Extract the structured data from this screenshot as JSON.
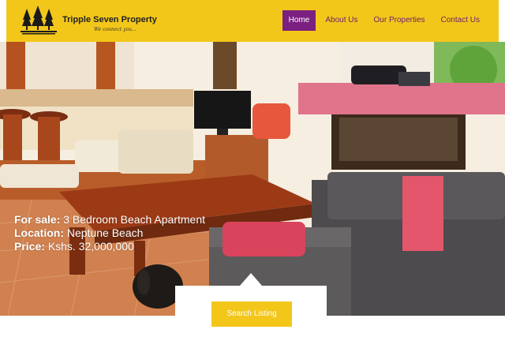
{
  "brand": {
    "name": "Tripple Seven Property",
    "tagline": "We connect you...",
    "logo_icon": "tree-logo-icon"
  },
  "nav": {
    "items": [
      {
        "label": "Home",
        "active": true
      },
      {
        "label": "About Us",
        "active": false
      },
      {
        "label": "Our Properties",
        "active": false
      },
      {
        "label": "Contact Us",
        "active": false
      }
    ]
  },
  "hero": {
    "line1_label": "For sale:",
    "line1_value": "3 Bedroom Beach Apartment",
    "line2_label": "Location:",
    "line2_value": "Neptune Beach",
    "line3_label": "Price:",
    "line3_value": "Kshs. 32,000,000"
  },
  "search": {
    "button_label": "Search Listing"
  },
  "colors": {
    "header_bg": "#f3c71a",
    "nav_active_bg": "#7b1f80",
    "nav_text": "#6b1f6b",
    "button_bg": "#f3c71a"
  }
}
